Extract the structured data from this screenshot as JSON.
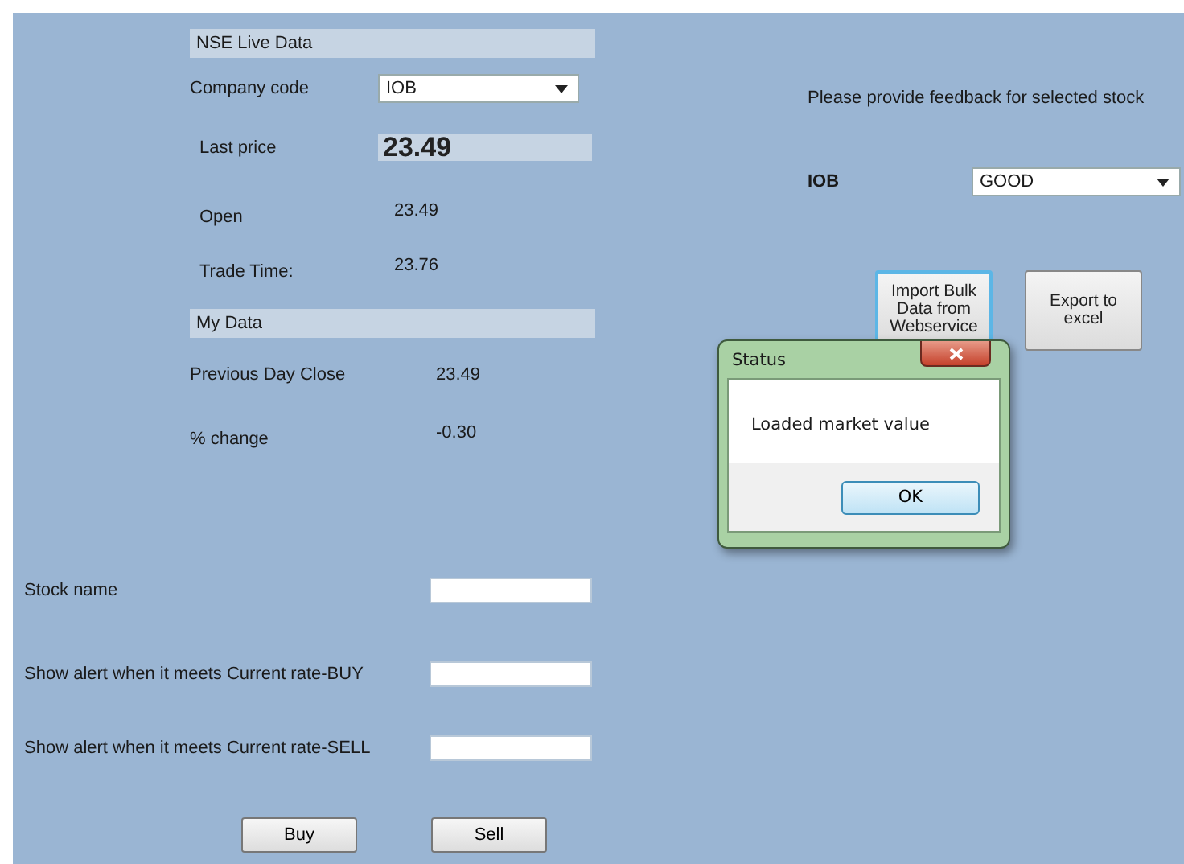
{
  "live_data": {
    "title": "NSE Live Data",
    "company_code": {
      "label": "Company code",
      "value": "IOB"
    },
    "last_price": {
      "label": "Last price",
      "value": "23.49"
    },
    "rows": [
      {
        "label": "Open",
        "value": "23.49"
      },
      {
        "label": "Trade Time:",
        "value": "23.76"
      }
    ]
  },
  "my_data": {
    "title": "My Data",
    "rows": [
      {
        "label": "Previous Day Close",
        "value": "23.49"
      },
      {
        "label": "% change",
        "value": "-0.30"
      }
    ]
  },
  "alert_fields": [
    {
      "label": "Stock name"
    },
    {
      "label": "Show alert when it meets Current rate-BUY"
    },
    {
      "label": "Show alert when it meets Current rate-SELL"
    }
  ],
  "trade_buttons": [
    "Buy",
    "Sell"
  ],
  "feedback": {
    "prompt": "Please provide feedback for selected stock",
    "stock": "IOB",
    "rating": "GOOD"
  },
  "tool_buttons": [
    {
      "label": "Import Bulk Data from Webservice",
      "focused": true
    },
    {
      "label": "Export to excel",
      "focused": false
    }
  ],
  "dialog": {
    "title": "Status",
    "message": "Loaded market value",
    "buttons": [
      "OK"
    ]
  }
}
